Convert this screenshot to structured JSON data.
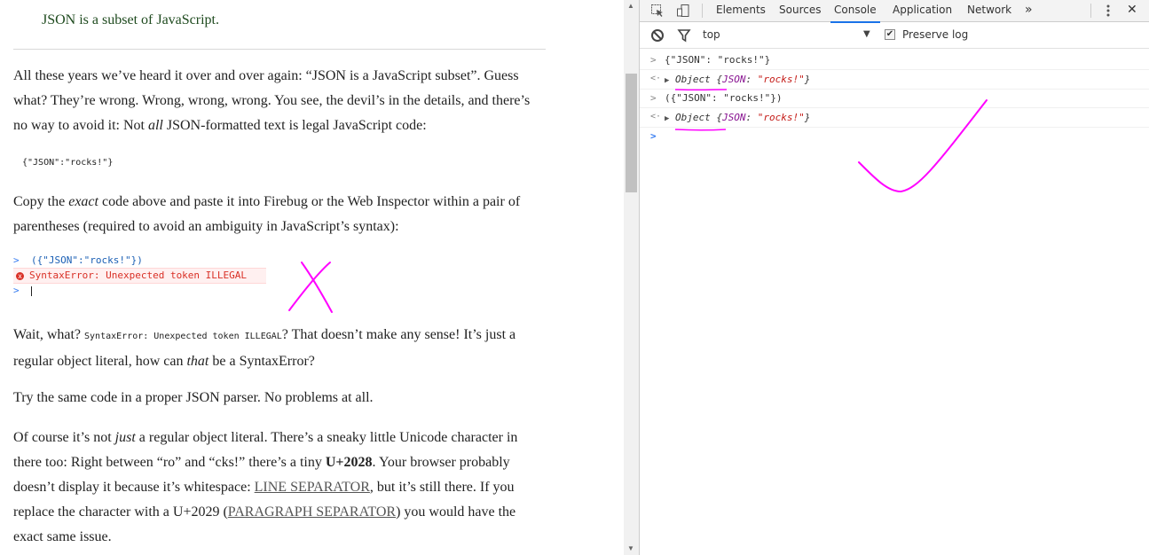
{
  "article": {
    "callout": "JSON is a subset of JavaScript.",
    "p1": {
      "text1": "All these years we’ve heard it over and over again: “JSON is a JavaScript subset”. Guess what? They’re wrong. Wrong, wrong, wrong. You see, the devil’s in the details, and there’s no way to avoid it: Not ",
      "em": "all",
      "text2": " JSON-formatted text is legal JavaScript code:"
    },
    "code_line": "{\"JSON\":\"rocks!\"}",
    "p2": {
      "text1": "Copy the ",
      "em": "exact",
      "text2": " code above and paste it into Firebug or the Web Inspector within a pair of parentheses (required to avoid an ambiguity in JavaScript’s syntax):"
    },
    "mini_console": {
      "prompt": ">",
      "input": "({\"JSON\":\"rocks!\"})",
      "error_icon": "x",
      "error": "SyntaxError: Unexpected token ILLEGAL"
    },
    "p3": {
      "text1": "Wait, what? ",
      "code": "SyntaxError: Unexpected token ILLEGAL",
      "text2": "? That doesn’t make any sense! It’s just a regular object literal, how can ",
      "em": "that",
      "text3": " be a SyntaxError?"
    },
    "p4": "Try the same code in a proper JSON parser. No problems at all.",
    "p5": {
      "text1": "Of course it’s not ",
      "em": "just",
      "text2": " a regular object literal. There’s a sneaky little Unicode character in there too: Right between “ro” and “cks!” there’s a tiny ",
      "bold": "U+2028",
      "text3": ". Your browser probably doesn’t display it because it’s whitespace: ",
      "link1": "LINE SEPARATOR",
      "text4": ", but it’s still there. If you replace the character with a U+2029 (",
      "link2": "PARAGRAPH SEPARATOR",
      "text5": ") you would have the exact same issue."
    }
  },
  "devtools": {
    "tabs": [
      "Elements",
      "Sources",
      "Console",
      "Application",
      "Network"
    ],
    "active_tab": "Console",
    "more_tabs": "»",
    "menu_icon": "kebab-icon",
    "close": "✕",
    "context": "top",
    "preserve_log": "Preserve log",
    "preserve_log_checked": true,
    "console_rows": [
      {
        "kind": "input",
        "icon": ">",
        "text": "{\"JSON\": \"rocks!\"}"
      },
      {
        "kind": "output",
        "icon": "<·",
        "label": "Object",
        "key": "JSON",
        "value": "\"rocks!\""
      },
      {
        "kind": "input",
        "icon": ">",
        "text": "({\"JSON\": \"rocks!\"})"
      },
      {
        "kind": "output",
        "icon": "<·",
        "label": "Object",
        "key": "JSON",
        "value": "\"rocks!\""
      }
    ],
    "prompt": ">"
  },
  "colors": {
    "annotation": "#ff00ff",
    "tab_active": "#1a73e8",
    "error_red": "#d93026",
    "string_red": "#c41a16",
    "prompt_blue": "#367cf1"
  }
}
